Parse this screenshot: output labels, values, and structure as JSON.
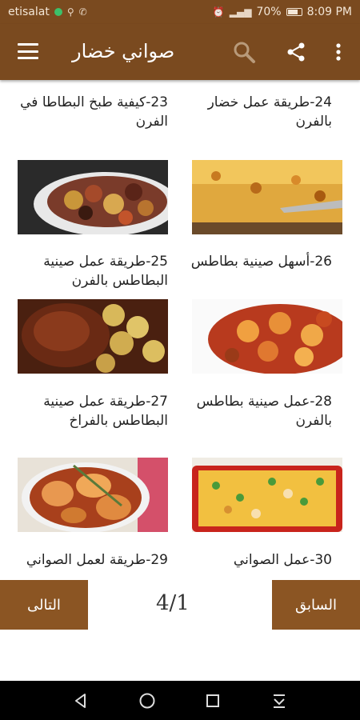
{
  "status": {
    "carrier": "etisalat",
    "battery": "70%",
    "time": "8:09 PM"
  },
  "app_bar": {
    "title": "صواني خضار"
  },
  "items": [
    {
      "title": "23-كيفية طبخ البطاطا في الفرن"
    },
    {
      "title": "24-طريقة عمل خضار بالفرن"
    },
    {
      "title": "25-طريقة عمل صينية البطاطس بالفرن"
    },
    {
      "title": "26-أسهل صينية بطاطس"
    },
    {
      "title": "27-طريقة عمل صينية البطاطس بالفراخ"
    },
    {
      "title": "28-عمل صينية بطاطس بالفرن"
    },
    {
      "title": "29-طريقة لعمل الصواني"
    },
    {
      "title": "30-عمل الصواني"
    }
  ],
  "footer": {
    "next_label": "التالى",
    "prev_label": "السابق",
    "page_indicator": "4/1"
  },
  "colors": {
    "app_bar": "#7a4a1f",
    "footer_button": "#8b5523"
  }
}
